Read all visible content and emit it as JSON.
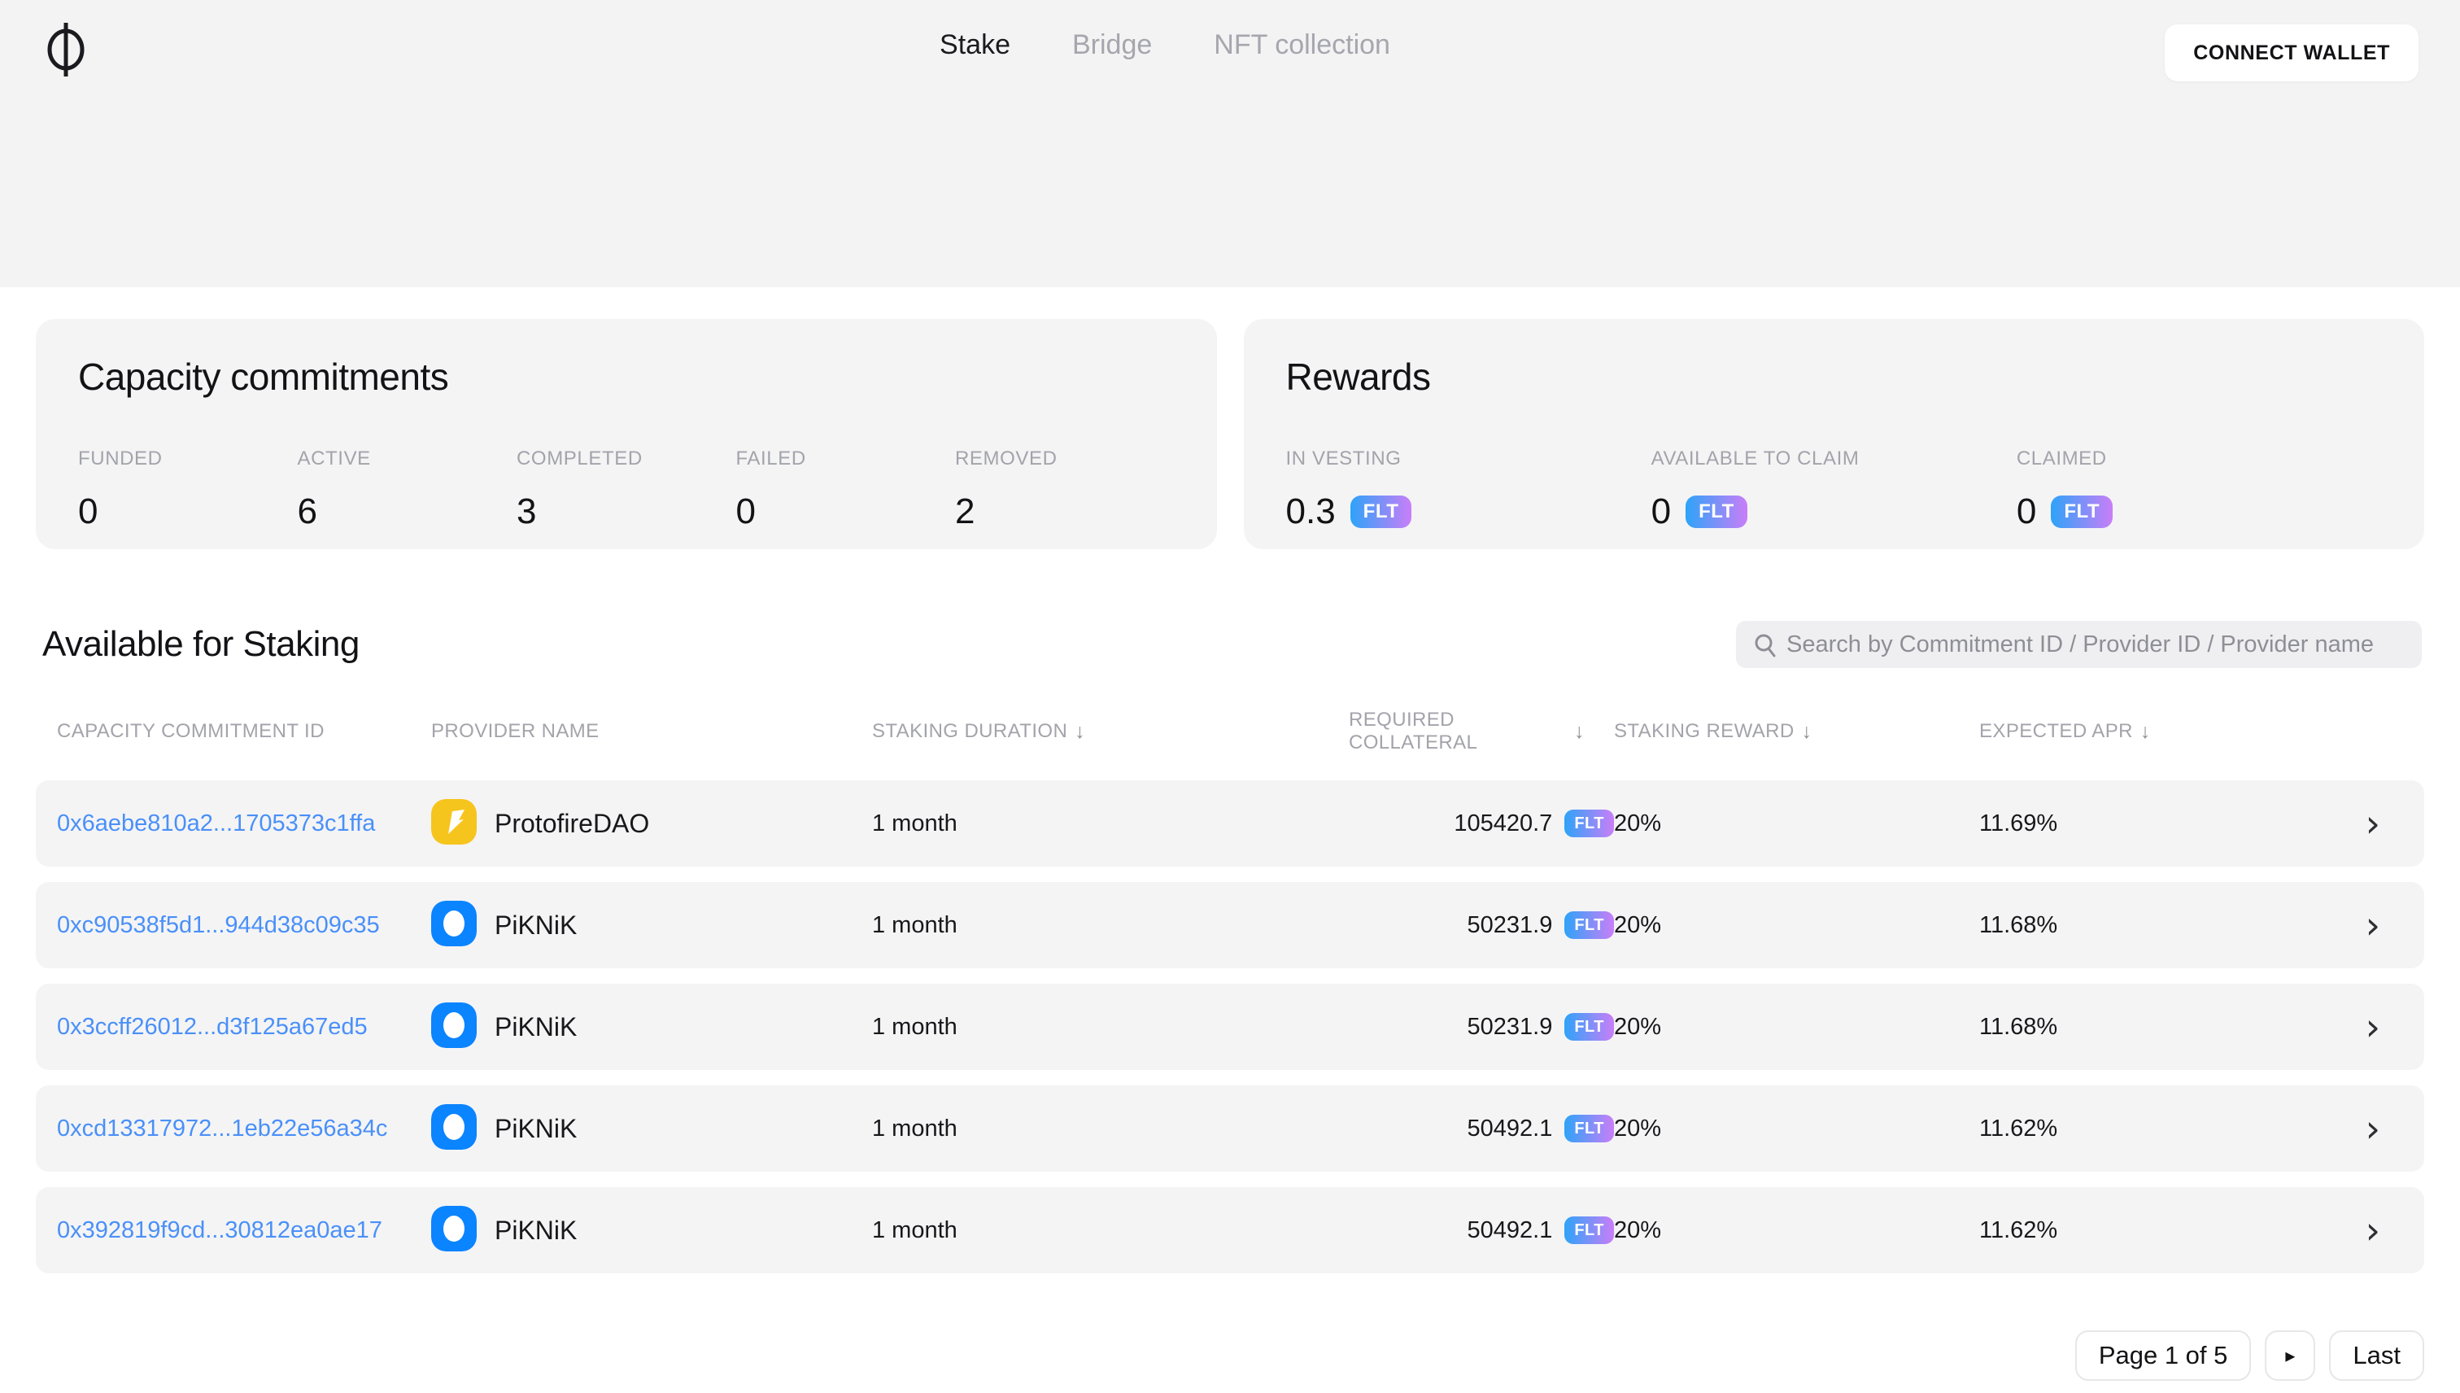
{
  "header": {
    "nav": [
      {
        "label": "Stake"
      },
      {
        "label": "Bridge"
      },
      {
        "label": "NFT collection"
      }
    ],
    "connect_wallet_label": "CONNECT WALLET"
  },
  "capacity_card": {
    "title": "Capacity commitments",
    "stats": [
      {
        "label": "FUNDED",
        "value": "0"
      },
      {
        "label": "ACTIVE",
        "value": "6"
      },
      {
        "label": "COMPLETED",
        "value": "3"
      },
      {
        "label": "FAILED",
        "value": "0"
      },
      {
        "label": "REMOVED",
        "value": "2"
      }
    ]
  },
  "rewards_card": {
    "title": "Rewards",
    "token": "FLT",
    "stats": [
      {
        "label": "IN VESTING",
        "value": "0.3"
      },
      {
        "label": "AVAILABLE TO CLAIM",
        "value": "0"
      },
      {
        "label": "CLAIMED",
        "value": "0"
      }
    ]
  },
  "staking": {
    "title": "Available for Staking",
    "search_placeholder": "Search by Commitment ID / Provider ID / Provider name",
    "sort_icon": "↓",
    "token": "FLT",
    "columns": {
      "id": "CAPACITY COMMITMENT ID",
      "provider": "PROVIDER NAME",
      "duration": "STAKING DURATION",
      "collateral": "REQUIRED COLLATERAL",
      "reward": "STAKING REWARD",
      "apr": "EXPECTED APR"
    },
    "rows": [
      {
        "id": "0x6aebe810a2...1705373c1ffa",
        "provider": "ProtofireDAO",
        "avatar": "protofire",
        "duration": "1 month",
        "collateral": "105420.7",
        "reward": "20%",
        "apr": "11.69%",
        "chevron": "›"
      },
      {
        "id": "0xc90538f5d1...944d38c09c35",
        "provider": "PiKNiK",
        "avatar": "piknik",
        "duration": "1 month",
        "collateral": "50231.9",
        "reward": "20%",
        "apr": "11.68%",
        "chevron": "›"
      },
      {
        "id": "0x3ccff26012...d3f125a67ed5",
        "provider": "PiKNiK",
        "avatar": "piknik",
        "duration": "1 month",
        "collateral": "50231.9",
        "reward": "20%",
        "apr": "11.68%",
        "chevron": "›"
      },
      {
        "id": "0xcd13317972...1eb22e56a34c",
        "provider": "PiKNiK",
        "avatar": "piknik",
        "duration": "1 month",
        "collateral": "50492.1",
        "reward": "20%",
        "apr": "11.62%",
        "chevron": "›"
      },
      {
        "id": "0x392819f9cd...30812ea0ae17",
        "provider": "PiKNiK",
        "avatar": "piknik",
        "duration": "1 month",
        "collateral": "50492.1",
        "reward": "20%",
        "apr": "11.62%",
        "chevron": "›"
      }
    ]
  },
  "pagination": {
    "page_label": "Page 1 of 5",
    "next_icon": "▸",
    "last_label": "Last"
  },
  "colors": {
    "band_bg": "#f3f3f4",
    "card_bg": "#f4f4f5",
    "link_blue": "#4a90f8",
    "badge_gradient_start": "#2ea3f8",
    "badge_gradient_end": "#c97ef8",
    "avatar_protofire": "#f6c51d",
    "avatar_piknik": "#0b84ff"
  }
}
